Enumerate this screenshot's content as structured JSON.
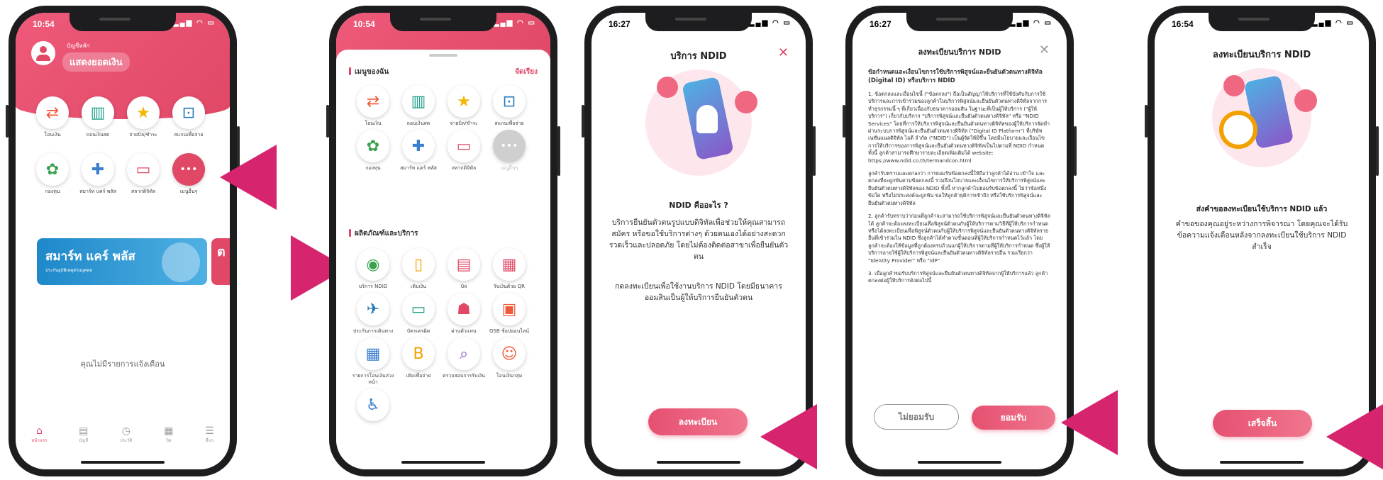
{
  "phone1": {
    "time": "10:54",
    "status_icons": "▂▄▆ ◠ ▭",
    "account_label": "บัญชีหลัก",
    "balance_button": "แสดงยอดเงิน",
    "row1": [
      {
        "label": "โอนเงิน",
        "icon": "⇄",
        "icon_name": "transfer-icon",
        "color": "#f05a3a"
      },
      {
        "label": "ถอนเงินสด",
        "icon": "▥",
        "icon_name": "cash-withdraw-icon",
        "color": "#22a08a"
      },
      {
        "label": "จ่ายบิล/ชำระ",
        "icon": "★",
        "icon_name": "star-icon",
        "color": "#f2b700"
      },
      {
        "label": "สแกนเพื่อจ่าย",
        "icon": "⊡",
        "icon_name": "scan-icon",
        "color": "#2277b8"
      }
    ],
    "row2": [
      {
        "label": "กองทุน",
        "icon": "✿",
        "icon_name": "fund-icon",
        "color": "#3aa14f"
      },
      {
        "label": "สมาร์ท แคร์ พลัส",
        "icon": "✚",
        "icon_name": "insurance-icon",
        "color": "#3b7fd1"
      },
      {
        "label": "สลากดิจิทัล",
        "icon": "▭",
        "icon_name": "lottery-icon",
        "color": "#e04866"
      },
      {
        "label": "เมนูอื่นๆ",
        "icon": "•••",
        "icon_name": "more-icon",
        "color": "#e04866"
      }
    ],
    "banner_title": "สมาร์ท แคร์ พลัส",
    "banner_subtitle": "ประกันอุบัติเหตุส่วนบุคคล",
    "banner_peek": "ต",
    "no_notifications": "คุณไม่มีรายการแจ้งเตือน",
    "tabs": [
      {
        "label": "หน้าแรก",
        "icon": "⌂",
        "icon_name": "home-icon",
        "active": true
      },
      {
        "label": "บัญชี",
        "icon": "▤",
        "icon_name": "account-icon",
        "active": false
      },
      {
        "label": "ประวัติ",
        "icon": "◷",
        "icon_name": "history-icon",
        "active": false
      },
      {
        "label": "บิล",
        "icon": "▦",
        "icon_name": "bill-icon",
        "active": false
      },
      {
        "label": "อื่นๆ",
        "icon": "☰",
        "icon_name": "menu-icon",
        "active": false
      }
    ]
  },
  "phone2": {
    "time": "10:54",
    "status_icons": "▂▄▆ ◠ ▭",
    "my_menu_title": "เมนูของฉัน",
    "edit_label": "จัดเรียง",
    "my_menu": [
      {
        "label": "โอนเงิน",
        "icon": "⇄",
        "icon_name": "transfer-icon",
        "color": "#f05a3a"
      },
      {
        "label": "ถอนเงินสด",
        "icon": "▥",
        "icon_name": "cash-withdraw-icon",
        "color": "#22a08a"
      },
      {
        "label": "จ่ายบิล/ชำระ",
        "icon": "★",
        "icon_name": "star-icon",
        "color": "#f2b700"
      },
      {
        "label": "สแกนเพื่อจ่าย",
        "icon": "⊡",
        "icon_name": "scan-icon",
        "color": "#2277b8"
      },
      {
        "label": "กองทุน",
        "icon": "✿",
        "icon_name": "fund-icon",
        "color": "#3aa14f"
      },
      {
        "label": "สมาร์ท แคร์ พลัส",
        "icon": "✚",
        "icon_name": "insurance-icon",
        "color": "#3b7fd1"
      },
      {
        "label": "สลากดิจิทัล",
        "icon": "▭",
        "icon_name": "lottery-icon",
        "color": "#e04866"
      },
      {
        "label": "เมนูอื่นๆ",
        "icon": "•••",
        "icon_name": "more-icon",
        "color": "#cfcfcf"
      }
    ],
    "products_title": "ผลิตภัณฑ์และบริการ",
    "products": [
      {
        "label": "บริการ NDID",
        "icon": "◉",
        "icon_name": "ndid-icon",
        "color": "#3aa14f"
      },
      {
        "label": "เติมเงิน",
        "icon": "▯",
        "icon_name": "topup-icon",
        "color": "#f2a100"
      },
      {
        "label": "บิล",
        "icon": "▤",
        "icon_name": "bill-icon",
        "color": "#e04866"
      },
      {
        "label": "รับเงินด้วย QR",
        "icon": "▦",
        "icon_name": "qr-icon",
        "color": "#e04866"
      },
      {
        "label": "ประกันการเดินทาง",
        "icon": "✈",
        "icon_name": "travel-icon",
        "color": "#2277b8"
      },
      {
        "label": "บัตรเครดิต",
        "icon": "▭",
        "icon_name": "credit-card-icon",
        "color": "#22a08a"
      },
      {
        "label": "ผ่านตัวแทน",
        "icon": "☗",
        "icon_name": "agent-icon",
        "color": "#e04866"
      },
      {
        "label": "GSB ช้อปออนไลน์",
        "icon": "▣",
        "icon_name": "shop-icon",
        "color": "#f05a3a"
      },
      {
        "label": "รายการโอนเงินล่วงหน้า",
        "icon": "▦",
        "icon_name": "calendar-icon",
        "color": "#3b7fd1"
      },
      {
        "label": "เติมเพื่อจ่าย",
        "icon": "B",
        "icon_name": "bitcoin-icon",
        "color": "#f2a100"
      },
      {
        "label": "ตรวจสอบการรับเงิน",
        "icon": "⌕",
        "icon_name": "search-icon",
        "color": "#8a58c9"
      },
      {
        "label": "โอนเงินกลุ่ม",
        "icon": "☺",
        "icon_name": "group-icon",
        "color": "#f05a3a"
      },
      {
        "label": "",
        "icon": "♿",
        "icon_name": "accessibility-icon",
        "color": "#3b7fd1"
      }
    ]
  },
  "phone3": {
    "time": "16:27",
    "status_icons": "▂▄▆ ◠ ▭",
    "title": "บริการ NDID",
    "close": "✕",
    "heading": "NDID คืออะไร ?",
    "body1": "บริการยืนยันตัวตนรูปแบบดิจิทัลเพื่อช่วยให้คุณสามารถสมัคร หรือขอใช้บริการต่างๆ ด้วยตนเองได้อย่างสะดวก รวดเร็วและปลอดภัย โดยไม่ต้องติดต่อสาขาเพื่อยืนยันตัวตน",
    "body2": "กดลงทะเบียนเพื่อใช้งานบริการ NDID โดยมีธนาคารออมสินเป็นผู้ให้บริการยืนยันตัวตน",
    "button": "ลงทะเบียน"
  },
  "phone4": {
    "time": "16:27",
    "status_icons": "▂▄▆ ◠ ▭",
    "title": "ลงทะเบียนบริการ NDID",
    "close": "✕",
    "terms_heading": "ข้อกำหนดและเงื่อนไขการใช้บริการพิสูจน์และยืนยันตัวตนทางดิจิทัล (Digital ID) หรือบริการ NDID",
    "terms": [
      "1. ข้อตกลงและเงื่อนไขนี้ (\"ข้อตกลง\") ถือเป็นสัญญาให้บริการที่ใช้บังคับกับการใช้บริการและการเข้าร่วมของลูกค้าในบริการพิสูจน์และยืนยันตัวตนทางดิจิทัลจากการทำธุรกรรมนี้ ๆ ที่เกี่ยวเนื่องกับธนาคารออมสิน ในฐานะที่เป็นผู้ให้บริการ (\"ผู้ให้บริการ\") เกี่ยวกับบริการ \"บริการพิสูจน์และยืนยันตัวตนทางดิจิทัล\" หรือ \"NDID Services\" โดยที่การให้บริการพิสูจน์และยืนยันตัวตนทางดิจิทัลของผู้ให้บริการจัดทำผ่านระบบการพิสูจน์และยืนยันตัวตนทางดิจิทัล (\"Digital ID Platform\") ที่บริษัท เนชั่นแนลดิจิทัล ไอดี จำกัด (\"NDID\") เป็นผู้จัดให้มีขึ้น โดยมีนโยบายและเงื่อนไขการให้บริการของการพิสูจน์และยืนยันตัวตนทางดิจิทัลเป็นไปตามที่ NDID กำหนด ทั้งนี้ ลูกค้าสามารถศึกษารายละเอียดเพิ่มเติมได้ website: https://www.ndid.co.th/termandcon.html",
      "ลูกค้ารับทราบและตกลงว่า การยอมรับข้อตกลงนี้ให้ถือว่าลูกค้าได้อ่าน เข้าใจ และตกลงที่จะผูกพันตามข้อตกลงนี้ รวมถึงนโยบายและเงื่อนไขการให้บริการพิสูจน์และยืนยันตัวตนทางดิจิทัลของ NDID ทั้งนี้ หากลูกค้าไม่ยอมรับข้อตกลงนี้ ไม่ว่าข้อหนึ่งข้อใด หรือไม่ประสงค์จะผูกพัน ขอให้ลูกค้ายุติการเข้าถึง หรือใช้บริการพิสูจน์และยืนยันตัวตนทางดิจิทัล",
      "2. ลูกค้ารับทราบว่าก่อนที่ลูกค้าจะสามารถใช้บริการพิสูจน์และยืนยันตัวตนทางดิจิทัลได้ ลูกค้าจะต้องลงทะเบียนเพื่อพิสูจน์ตัวตนกับผู้ให้บริการตามวิธีที่ผู้ให้บริการกำหนด หรือได้ลงทะเบียนเพื่อพิสูจน์ตัวตนกับผู้ให้บริการพิสูจน์และยืนยันตัวตนทางดิจิทัลรายอื่นที่เข้าร่วมใน NDID ซึ่งลูกค้าได้ทำตามขั้นตอนที่ผู้ให้บริการกำหนดไว้แล้ว โดยลูกค้าจะต้องให้ข้อมูลที่ถูกต้องครบถ้วนแก่ผู้ให้บริการตามที่ผู้ให้บริการกำหนด ซึ่งผู้ให้บริการอาจใช้ผู้ให้บริการพิสูจน์และยืนยันตัวตนทางดิจิทัลรายอื่น รวมเรียกว่า \"Identity Provider\" หรือ \"IdP\"",
      "3. เมื่อลูกค้าขอรับบริการพิสูจน์และยืนยันตัวตนทางดิจิทัลจากผู้ให้บริการแล้ว ลูกค้าตกลงต่อผู้ให้บริการดังต่อไปนี้"
    ],
    "decline": "ไม่ยอมรับ",
    "accept": "ยอมรับ"
  },
  "phone5": {
    "time": "16:54",
    "status_icons": "▂▄▆ ◠ ▭",
    "title": "ลงทะเบียนบริการ NDID",
    "heading": "ส่งคำขอลงทะเบียนใช้บริการ NDID แล้ว",
    "body": "คำขอของคุณอยู่ระหว่างการพิจารณา โดยคุณจะได้รับข้อความแจ้งเตือนหลังจากลงทะเบียนใช้บริการ NDID สำเร็จ",
    "button": "เสร็จสิ้น"
  },
  "colors": {
    "brand_pink": "#e04866",
    "arrow": "#d6246e"
  }
}
